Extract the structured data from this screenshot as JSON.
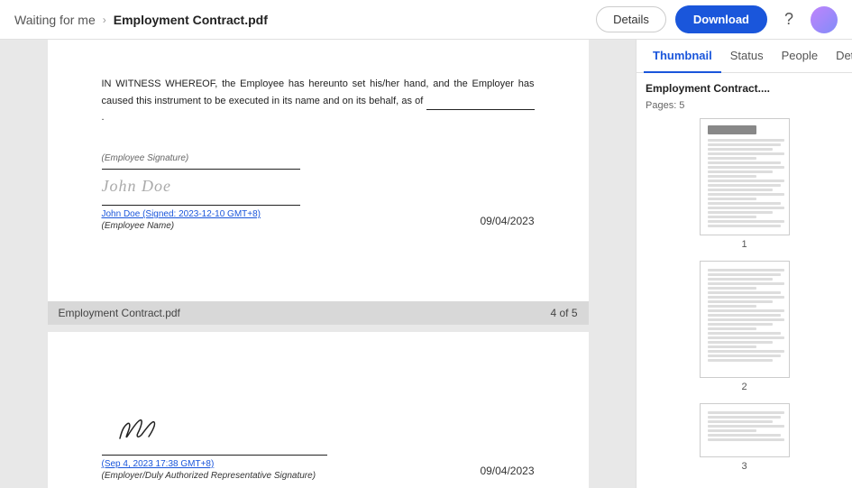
{
  "header": {
    "breadcrumb_prefix": "Waiting for me",
    "separator": "›",
    "filename": "Employment Contract.pdf",
    "btn_details": "Details",
    "btn_download": "Download"
  },
  "document": {
    "page4": {
      "witness_text": "IN WITNESS WHEREOF, the Employee has hereunto set his/her hand, and the Employer has caused this instrument to be executed in its name and on its behalf, as of",
      "sig_label": "(Employee Signature)",
      "sig_name": "John Doe",
      "sig_signed": "John Doe (Signed: 2023-12-10 GMT+8)",
      "sig_name_label": "(Employee Name)",
      "sig_date": "09/04/2023"
    },
    "footer": {
      "filename": "Employment Contract.pdf",
      "page_info": "4 of 5"
    },
    "page5": {
      "employer_sig_date": "(Sep 4, 2023 17:38 GMT+8)",
      "employer_sig_label": "(Employer/Duly Authorized Representative Signature)",
      "sig_date": "09/04/2023"
    }
  },
  "right_panel": {
    "tabs": [
      {
        "label": "Thumbnail",
        "active": true
      },
      {
        "label": "Status",
        "active": false
      },
      {
        "label": "People",
        "active": false
      },
      {
        "label": "Details",
        "active": false
      }
    ],
    "thumbnail_filename": "Employment Contract....",
    "thumbnail_pages": "Pages: 5",
    "thumbnails": [
      {
        "number": "1"
      },
      {
        "number": "2"
      },
      {
        "number": "3"
      }
    ]
  }
}
